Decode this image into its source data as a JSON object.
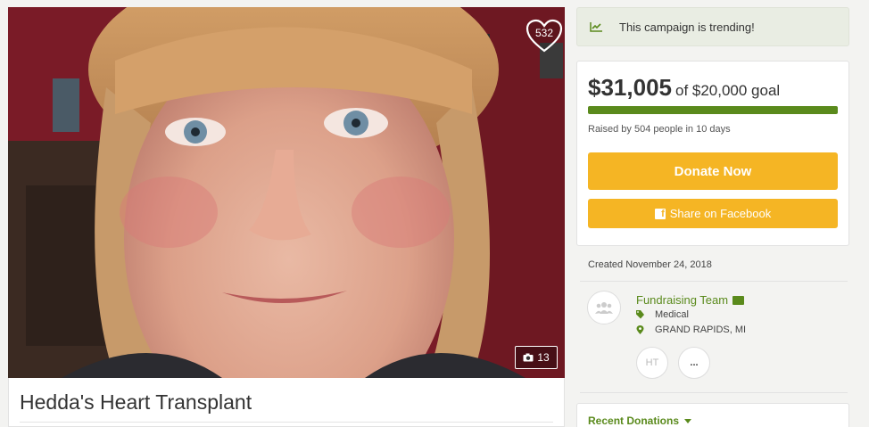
{
  "hero": {
    "heart_count": "532",
    "photo_count": "13"
  },
  "campaign": {
    "title": "Hedda's Heart Transplant",
    "trending_text": "This campaign is trending!",
    "amount_raised": "$31,005",
    "goal_text": "of $20,000 goal",
    "progress_fraction": 1.0,
    "raised_by": "Raised by 504 people in 10 days",
    "donate_label": "Donate Now",
    "share_label": "Share on Facebook",
    "created": "Created November 24, 2018"
  },
  "organizer": {
    "team_name": "Fundraising Team",
    "category": "Medical",
    "location": "GRAND RAPIDS, MI",
    "initials": "HT",
    "more_label": "..."
  },
  "recent": {
    "title": "Recent Donations"
  },
  "colors": {
    "accent_green": "#5a8a1c",
    "donate_yellow": "#f5b524",
    "trending_bg": "#e9ede3"
  }
}
